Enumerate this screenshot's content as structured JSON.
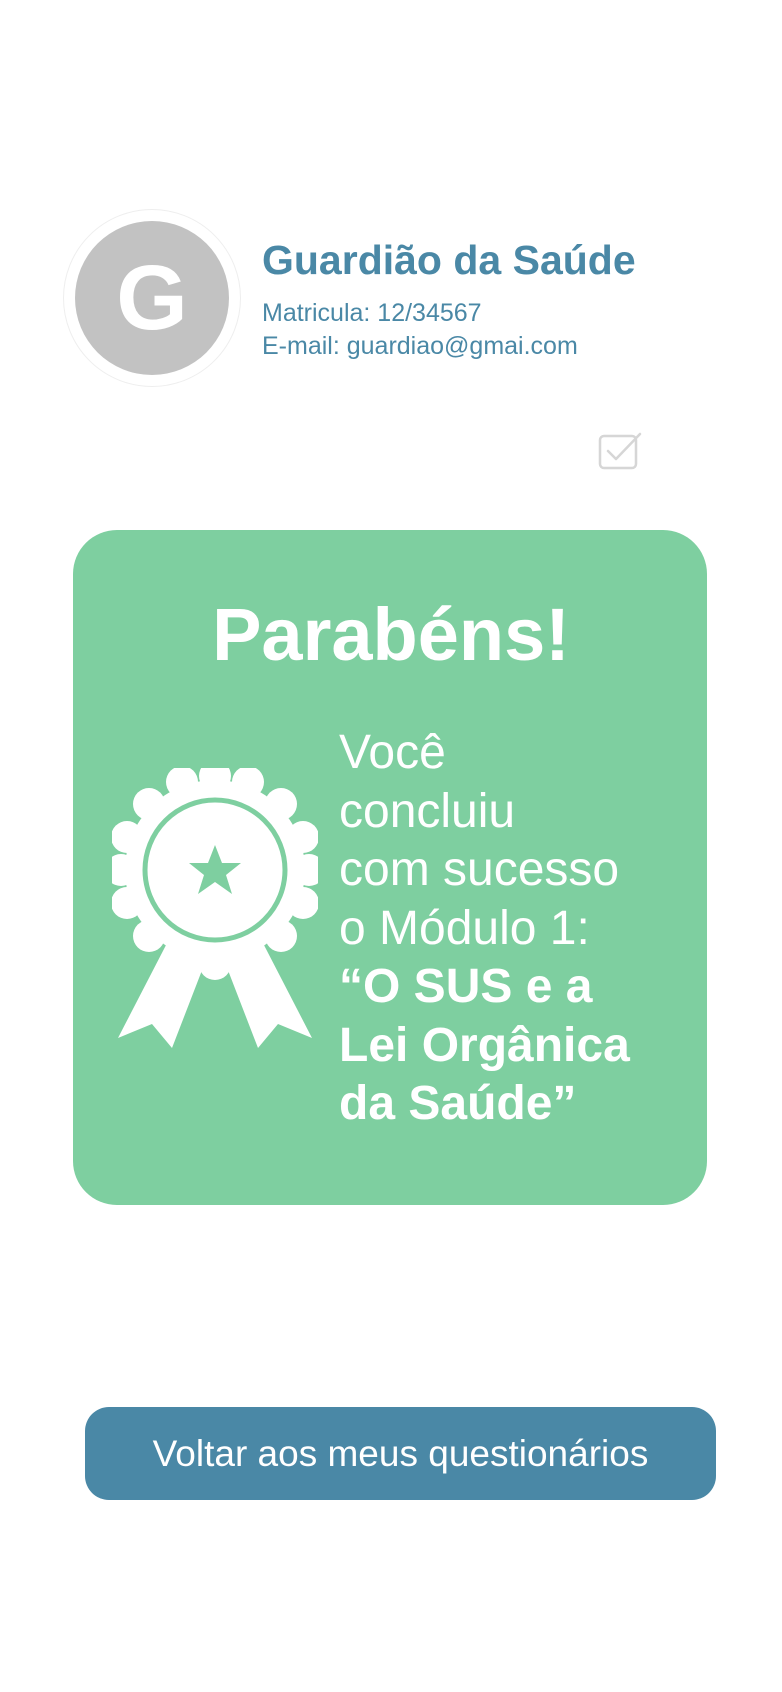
{
  "profile": {
    "avatar_initial": "G",
    "name": "Guardião da Saúde",
    "registration": "Matricula: 12/34567",
    "email": "E-mail: guardiao@gmai.com"
  },
  "status_icon": "checkbox-checked-icon",
  "result_card": {
    "title": "Parabéns!",
    "message_lines": [
      "Você",
      "concluiu",
      "com sucesso",
      "o Módulo 1:"
    ],
    "module_name": "“O SUS e a\nLei Orgânica\nda Saúde”",
    "icon": "award-ribbon-icon",
    "color": "#7ecfa0"
  },
  "actions": {
    "back_label": "Voltar aos meus questionários"
  },
  "colors": {
    "primary": "#4a88a6",
    "success": "#7ecfa0",
    "avatar_bg": "#c2c2c2"
  }
}
